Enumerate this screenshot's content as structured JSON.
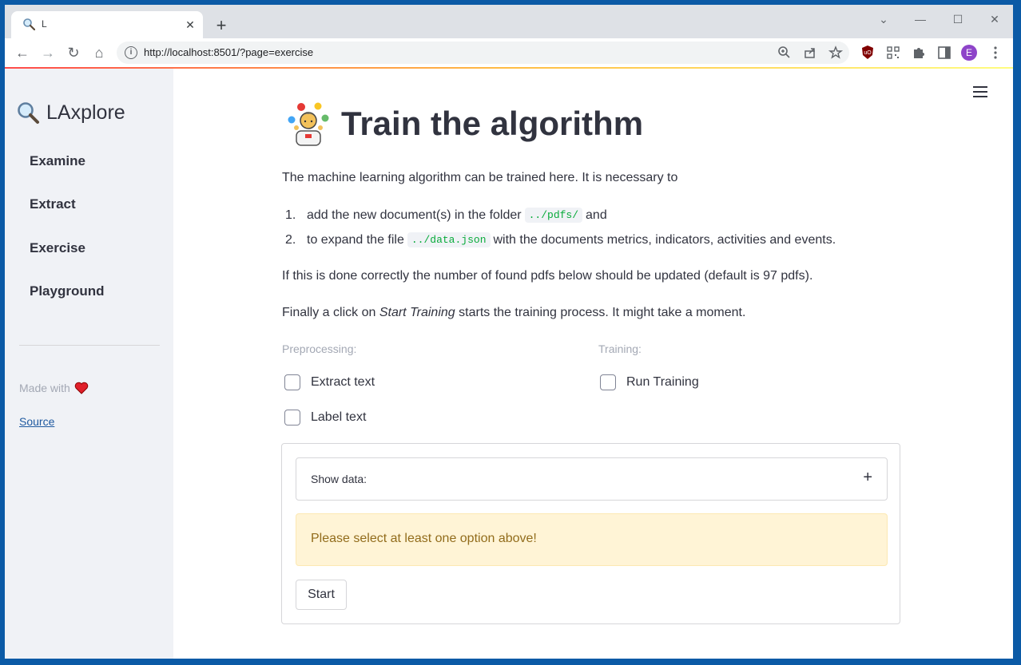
{
  "browser": {
    "tab": {
      "title": "L",
      "close_glyph": "✕"
    },
    "new_tab_glyph": "+",
    "window_controls": {
      "dropdown": "⌄",
      "minimize": "—",
      "maximize": "☐",
      "close": "✕"
    },
    "nav": {
      "back": "←",
      "forward": "→",
      "reload": "↻",
      "home": "⌂"
    },
    "url": "http://localhost:8501/?page=exercise",
    "profile_initial": "E"
  },
  "sidebar": {
    "title": "LAxplore",
    "items": [
      {
        "label": "Examine"
      },
      {
        "label": "Extract"
      },
      {
        "label": "Exercise"
      },
      {
        "label": "Playground"
      }
    ],
    "made_with": "Made with",
    "source_link": "Source"
  },
  "main": {
    "title": "Train the algorithm",
    "intro": "The machine learning algorithm can be trained here. It is necessary to",
    "list": [
      {
        "num": "1.",
        "before": "add the new document(s) in the folder",
        "code": "../pdfs/",
        "after": "and"
      },
      {
        "num": "2.",
        "before": "to expand the file",
        "code": "../data.json",
        "after": "with the documents metrics, indicators, activities and events."
      }
    ],
    "check_note": "If this is done correctly the number of found pdfs below should be updated (default is 97 pdfs).",
    "finally_before": "Finally a click on",
    "finally_em": "Start Training",
    "finally_after": "starts the training process. It might take a moment.",
    "preprocessing_label": "Preprocessing:",
    "training_label": "Training:",
    "checkboxes": {
      "extract_text": "Extract text",
      "label_text": "Label text",
      "run_training": "Run Training"
    },
    "expander_label": "Show data:",
    "expander_glyph": "+",
    "warning": "Please select at least one option above!",
    "start_button": "Start"
  },
  "colors": {
    "accent": "#ff4b4b",
    "sidebar_bg": "#f0f2f6",
    "warning_bg": "#fff4d6",
    "warning_text": "#926c1c",
    "code_text": "#09ab3b"
  }
}
